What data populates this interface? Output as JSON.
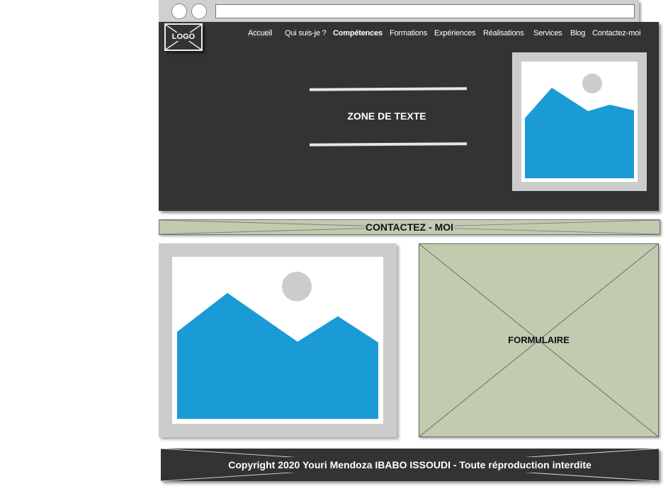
{
  "logo": {
    "text": "LOGO"
  },
  "nav": {
    "items": [
      {
        "label": "Accueil"
      },
      {
        "label": "Qui suis-je ?"
      },
      {
        "label": "Compétences"
      },
      {
        "label": "Formations"
      },
      {
        "label": "Expériences"
      },
      {
        "label": "Réalisations"
      },
      {
        "label": "Services"
      },
      {
        "label": "Blog"
      },
      {
        "label": "Contactez-moi"
      }
    ]
  },
  "hero": {
    "text": "ZONE DE TEXTE"
  },
  "contact": {
    "title": "CONTACTEZ - MOI",
    "form_label": "FORMULAIRE"
  },
  "footer": {
    "copyright": "Copyright 2020 Youri Mendoza IBABO ISSOUDI - Toute réproduction interdite"
  },
  "colors": {
    "header_bg": "#333333",
    "placeholder_green": "#c1cbb0",
    "image_blue": "#1a9bd6",
    "frame_gray": "#cccccc"
  }
}
